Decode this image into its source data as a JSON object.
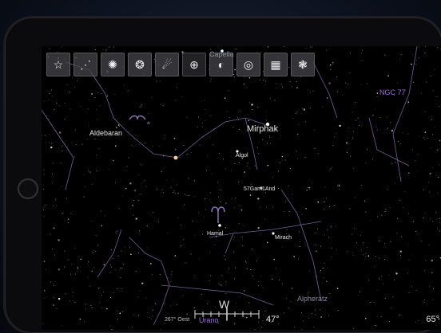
{
  "toolbar": [
    {
      "name": "favorites-button",
      "icon": "☆"
    },
    {
      "name": "constellation-lines-button",
      "icon": "⋰"
    },
    {
      "name": "galaxy-button",
      "icon": "✺"
    },
    {
      "name": "nebula-button",
      "icon": "❂"
    },
    {
      "name": "comet-button",
      "icon": "☄"
    },
    {
      "name": "target-button",
      "icon": "⊕"
    },
    {
      "name": "moon-phase-button",
      "icon": "◐"
    },
    {
      "name": "ring-button",
      "icon": "◎"
    },
    {
      "name": "grid-button",
      "icon": "▦"
    },
    {
      "name": "aperture-button",
      "icon": "❃"
    }
  ],
  "labels": {
    "capella": "Capella",
    "aldebaran": "Aldebaran",
    "mirphak": "Mirphak",
    "algol": "Algol",
    "gam1and": "57Gam1And",
    "hamal": "Hamal",
    "mirach": "Mirach",
    "alpheratz": "Alpheratz",
    "ngc": "NGC 77",
    "uranus": "Urano"
  },
  "compass": {
    "direction": "W",
    "azimuth": "267° Oest",
    "altitude": "47°",
    "fov": "65°"
  },
  "colors": {
    "constellation_lines": "#8a6fb0",
    "planet_labels": "#9a6bd6"
  }
}
